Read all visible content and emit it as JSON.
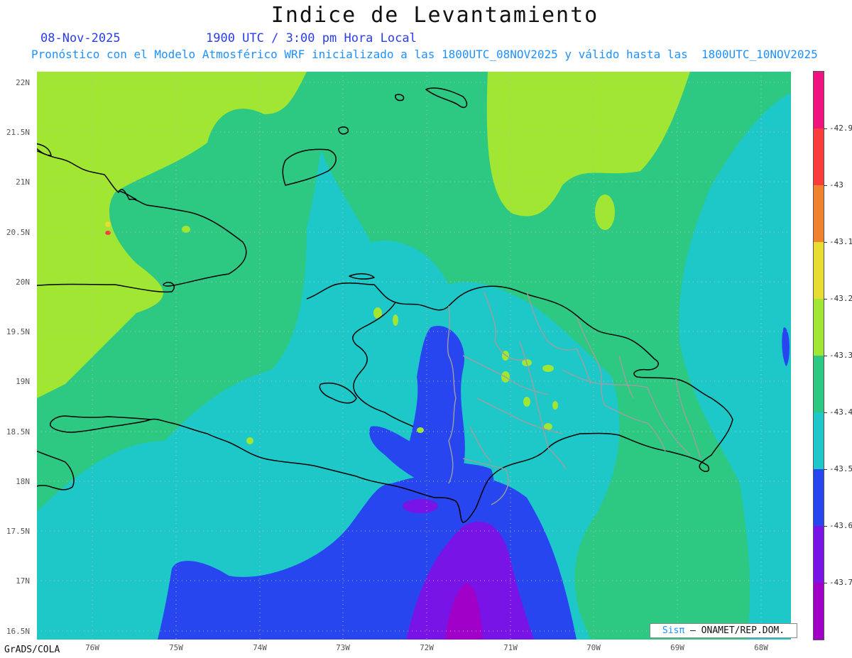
{
  "title": "Indice de Levantamiento",
  "date": "08-Nov-2025",
  "time": "1900 UTC / 3:00 pm Hora Local",
  "subtitle": "Pronóstico con el Modelo Atmosférico WRF inicializado a las 1800UTC_08NOV2025 y válido hasta las  1800UTC_10NOV2025",
  "footer": "GrADS/COLA",
  "credit": {
    "sis": "Sisπ",
    "org": " – ONAMET/REP.DOM."
  },
  "lat_labels": [
    "22N",
    "21.5N",
    "21N",
    "20.5N",
    "20N",
    "19.5N",
    "19N",
    "18.5N",
    "18N",
    "17.5N",
    "17N",
    "16.5N"
  ],
  "lon_labels": [
    "76W",
    "75W",
    "74W",
    "73W",
    "72W",
    "71W",
    "70W",
    "69W",
    "68W"
  ],
  "colorbar": {
    "labels": [
      "-42.9",
      "-43",
      "-43.1",
      "-43.2",
      "-43.3",
      "-43.4",
      "-43.5",
      "-43.6",
      "-43.7"
    ],
    "colors": [
      "#f0127f",
      "#fa3c3c",
      "#f0822d",
      "#e6dc32",
      "#a0e632",
      "#2dc882",
      "#1ec8c8",
      "#2846f0",
      "#7814e6",
      "#a000c8"
    ]
  }
}
